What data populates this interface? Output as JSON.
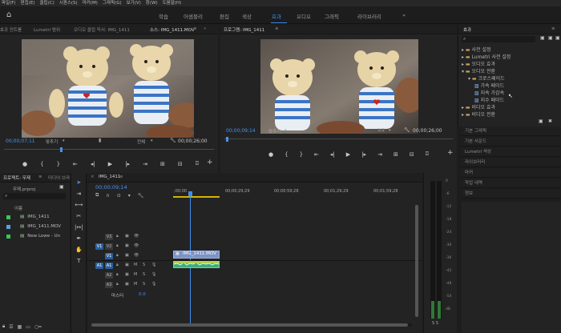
{
  "menu": [
    "파일(F)",
    "편집(E)",
    "클립(C)",
    "시퀀스(S)",
    "마커(M)",
    "그래픽(G)",
    "보기(V)",
    "창(W)",
    "도움말(H)"
  ],
  "workspaces": [
    "학습",
    "어셈블리",
    "편집",
    "색상",
    "효과",
    "오디오",
    "그래픽",
    "라이브러리"
  ],
  "workspace_more": "»",
  "left_monitor": {
    "tabs": [
      "효과 컨트롤",
      "Lumetri 범위",
      "오디오 클립 믹서: IMG_1411",
      "소스: IMG_1411.MOV"
    ],
    "timecode": "00;00;07;11",
    "fit": "맞추기",
    "quality": "전체",
    "duration": "00;00;26;00"
  },
  "right_monitor": {
    "tab": "프로그램: IMG_1411",
    "timecode": "00;00;09;14",
    "fit": "맞추기",
    "ratio": "1/2",
    "duration": "00;00;26;00"
  },
  "project": {
    "tabs": [
      "프로젝트: 무제",
      "미디어 브라우저"
    ],
    "file": "무제.prproj",
    "col_name": "이름",
    "items": [
      {
        "name": "IMG_1411",
        "color": "#34c759"
      },
      {
        "name": "IMG_1411.MOV",
        "color": "#5aa0e6"
      },
      {
        "name": "New Lowe - Un",
        "color": "#34c759"
      }
    ]
  },
  "timeline": {
    "tab": "IMG_1411",
    "timecode": "00;00;09;14",
    "ruler": [
      ";00;00",
      "00;00;29;29",
      "00;00;59;28",
      "00;01;29;29",
      "00;01;59;28"
    ],
    "video_tracks": [
      "V3",
      "V2",
      "V1"
    ],
    "audio_tracks": [
      "A1",
      "A2",
      "A3"
    ],
    "master_label": "마스터",
    "master_value": "0.0",
    "clip_name": "IMG_1411.MOV"
  },
  "meter": {
    "labels": [
      "0",
      "-6",
      "-12",
      "-18",
      "-24",
      "-30",
      "-36",
      "-42",
      "-48",
      "-54",
      "dB"
    ],
    "solo": "S S"
  },
  "effects": {
    "tab": "효과",
    "tree": [
      {
        "label": "사전 설정",
        "indent": 0,
        "expanded": false
      },
      {
        "label": "Lumetri 사전 설정",
        "indent": 0,
        "expanded": false
      },
      {
        "label": "오디오 효과",
        "indent": 0,
        "expanded": false
      },
      {
        "label": "오디오 전환",
        "indent": 0,
        "expanded": true
      },
      {
        "label": "크로스페이드",
        "indent": 1,
        "expanded": true
      },
      {
        "label": "가속 페이드",
        "indent": 2,
        "expanded": false
      },
      {
        "label": "지속 가감속",
        "indent": 2,
        "expanded": false
      },
      {
        "label": "지수 페이드",
        "indent": 2,
        "expanded": false
      },
      {
        "label": "비디오 효과",
        "indent": 0,
        "expanded": false
      },
      {
        "label": "비디오 전환",
        "indent": 0,
        "expanded": false
      }
    ],
    "side_panels": [
      "기본 그래픽",
      "기본 사운드",
      "Lumetri 색상",
      "라이브러리",
      "마커",
      "작업 내역",
      "정보"
    ]
  },
  "colors": {
    "accent": "#3d8ef0",
    "panel": "#232323",
    "timeline_clip": "#7b93c7",
    "audio_clip": "#3fae7a"
  }
}
